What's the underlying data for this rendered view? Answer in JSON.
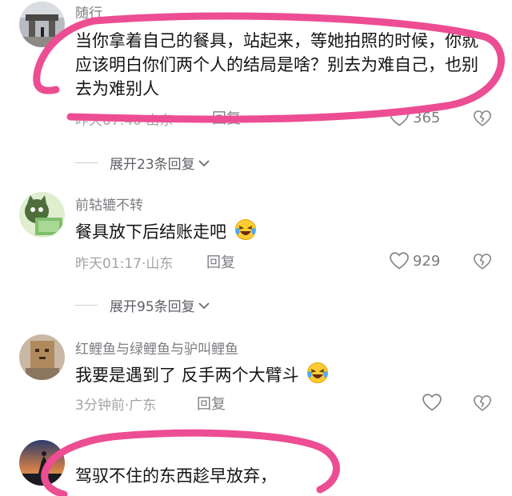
{
  "comments": [
    {
      "username": "随行",
      "text": "当你拿着自己的餐具，站起来，等她拍照的时候，你就应该明白你们两个人的结局是啥？别去为难自己，也别去为难别人",
      "time_location": "昨天07:40·山东",
      "reply_label": "回复",
      "likes": "365",
      "expand_label": "展开23条回复",
      "avatar_icon": "gate-photo"
    },
    {
      "username": "前轱辘不转",
      "text": "餐具放下后结账走吧",
      "emoji": "laughing-emoji",
      "time_location": "昨天01:17·山东",
      "reply_label": "回复",
      "likes": "929",
      "expand_label": "展开95条回复",
      "avatar_icon": "cartoon-cat"
    },
    {
      "username": "红鲤鱼与绿鲤鱼与驴叫鲤鱼",
      "text": "我要是遇到了 反手两个大臂斗",
      "emoji": "laughing-emoji",
      "time_location": "3分钟前·广东",
      "reply_label": "回复",
      "likes": "",
      "avatar_icon": "paper-bag-cat"
    },
    {
      "username": "",
      "text": "驾驭不住的东西趁早放弃，",
      "avatar_icon": "sunset-silhouette"
    }
  ],
  "colors": {
    "highlight": "#ec4d93",
    "username": "#7d7d82",
    "meta": "#a4a4a8",
    "body": "#141414"
  }
}
